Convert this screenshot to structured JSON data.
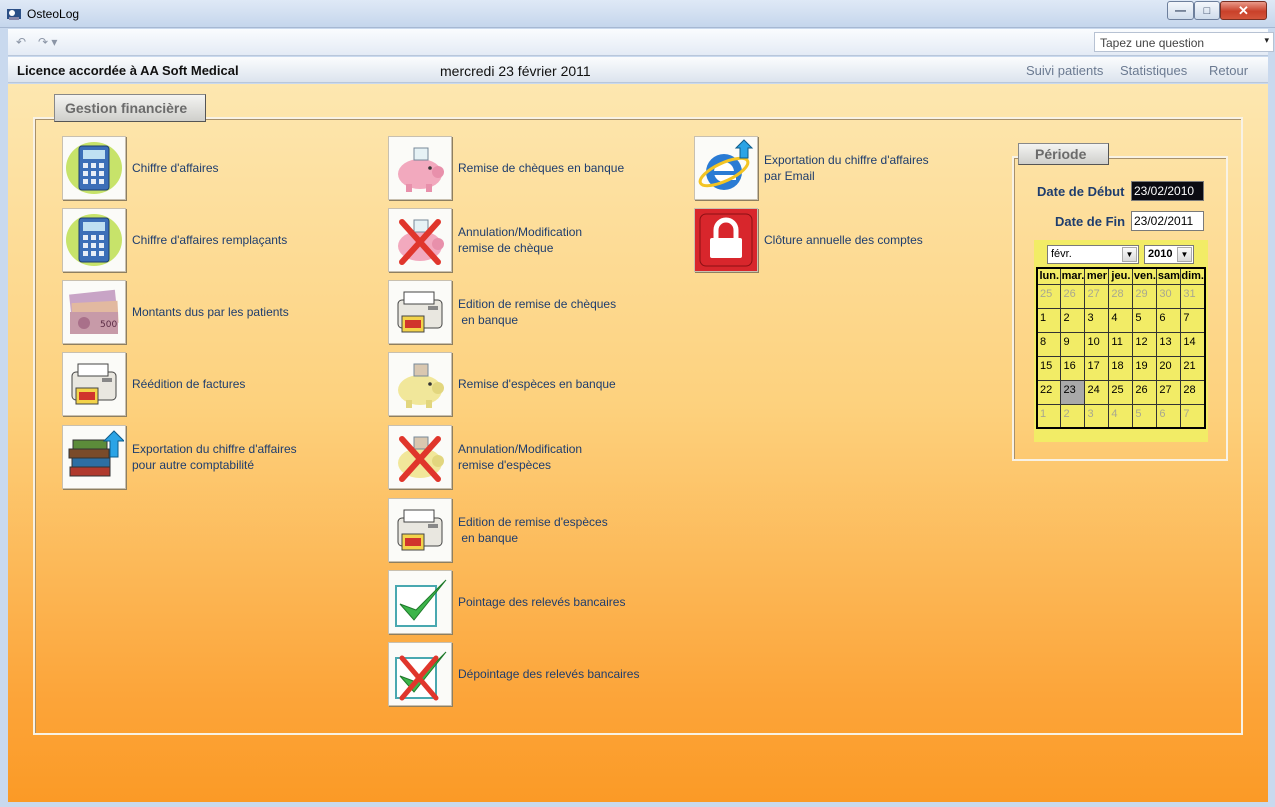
{
  "window": {
    "title": "OsteoLog",
    "minimize_glyph": "—",
    "maximize_glyph": "□",
    "close_glyph": "✕"
  },
  "toolbar": {
    "undo_glyph": "↶",
    "redo_glyph": "↷ ▾",
    "help_placeholder": "Tapez une question",
    "help_arrow": "▾"
  },
  "header": {
    "licence": "Licence accordée à  AA Soft Medical",
    "date": "mercredi 23 février 2011",
    "nav": [
      "Suivi patients",
      "Statistiques",
      "Retour"
    ]
  },
  "main": {
    "tab": "Gestion financière",
    "col1": [
      {
        "label": "Chiffre d'affaires",
        "icon": "calculator-icon"
      },
      {
        "label": "Chiffre d'affaires remplaçants",
        "icon": "calculator-icon"
      },
      {
        "label": "Montants dus par les patients",
        "icon": "banknotes-icon"
      },
      {
        "label": "Réédition de factures",
        "icon": "printer-icon"
      },
      {
        "label": "Exportation du chiffre d'affaires\npour autre comptabilité",
        "icon": "books-export-icon"
      }
    ],
    "col2": [
      {
        "label": "Remise de chèques en banque",
        "icon": "piggy-bank-pink-icon"
      },
      {
        "label": "Annulation/Modification\nremise de chèque",
        "icon": "piggy-bank-pink-cancel-icon"
      },
      {
        "label": "Edition de remise de chèques\n en banque",
        "icon": "printer-icon"
      },
      {
        "label": "Remise d'espèces en banque",
        "icon": "piggy-bank-yellow-icon"
      },
      {
        "label": "Annulation/Modification\nremise d'espèces",
        "icon": "piggy-bank-yellow-cancel-icon"
      },
      {
        "label": "Edition de remise d'espèces\n en banque",
        "icon": "printer-icon"
      },
      {
        "label": "Pointage des relevés bancaires",
        "icon": "checkmark-icon"
      },
      {
        "label": "Dépointage des relevés bancaires",
        "icon": "checkmark-cancel-icon"
      }
    ],
    "col3": [
      {
        "label": "Exportation du chiffre d'affaires\npar Email",
        "icon": "internet-explorer-icon"
      },
      {
        "label": "Clôture annuelle des comptes",
        "icon": "padlock-icon"
      }
    ]
  },
  "periode": {
    "tab": "Période",
    "start_label": "Date de Début",
    "start_value": "23/02/2010",
    "end_label": "Date de Fin",
    "end_value": "23/02/2011",
    "calendar": {
      "month": "févr.",
      "year": "2010",
      "arrow": "▼",
      "days": [
        "lun.",
        "mar.",
        "mer",
        "jeu.",
        "ven.",
        "sam",
        "dim."
      ],
      "weeks": [
        [
          "25",
          "26",
          "27",
          "28",
          "29",
          "30",
          "31"
        ],
        [
          "1",
          "2",
          "3",
          "4",
          "5",
          "6",
          "7"
        ],
        [
          "8",
          "9",
          "10",
          "11",
          "12",
          "13",
          "14"
        ],
        [
          "15",
          "16",
          "17",
          "18",
          "19",
          "20",
          "21"
        ],
        [
          "22",
          "23",
          "24",
          "25",
          "26",
          "27",
          "28"
        ],
        [
          "1",
          "2",
          "3",
          "4",
          "5",
          "6",
          "7"
        ]
      ],
      "selected": "23",
      "colors": {
        "background": "#f2ec66",
        "selected": "#a9a9a9"
      }
    }
  },
  "colors": {
    "gradient_top": "#fde7b0",
    "gradient_bottom": "#fb9a26",
    "text": "#1e3d6e"
  }
}
